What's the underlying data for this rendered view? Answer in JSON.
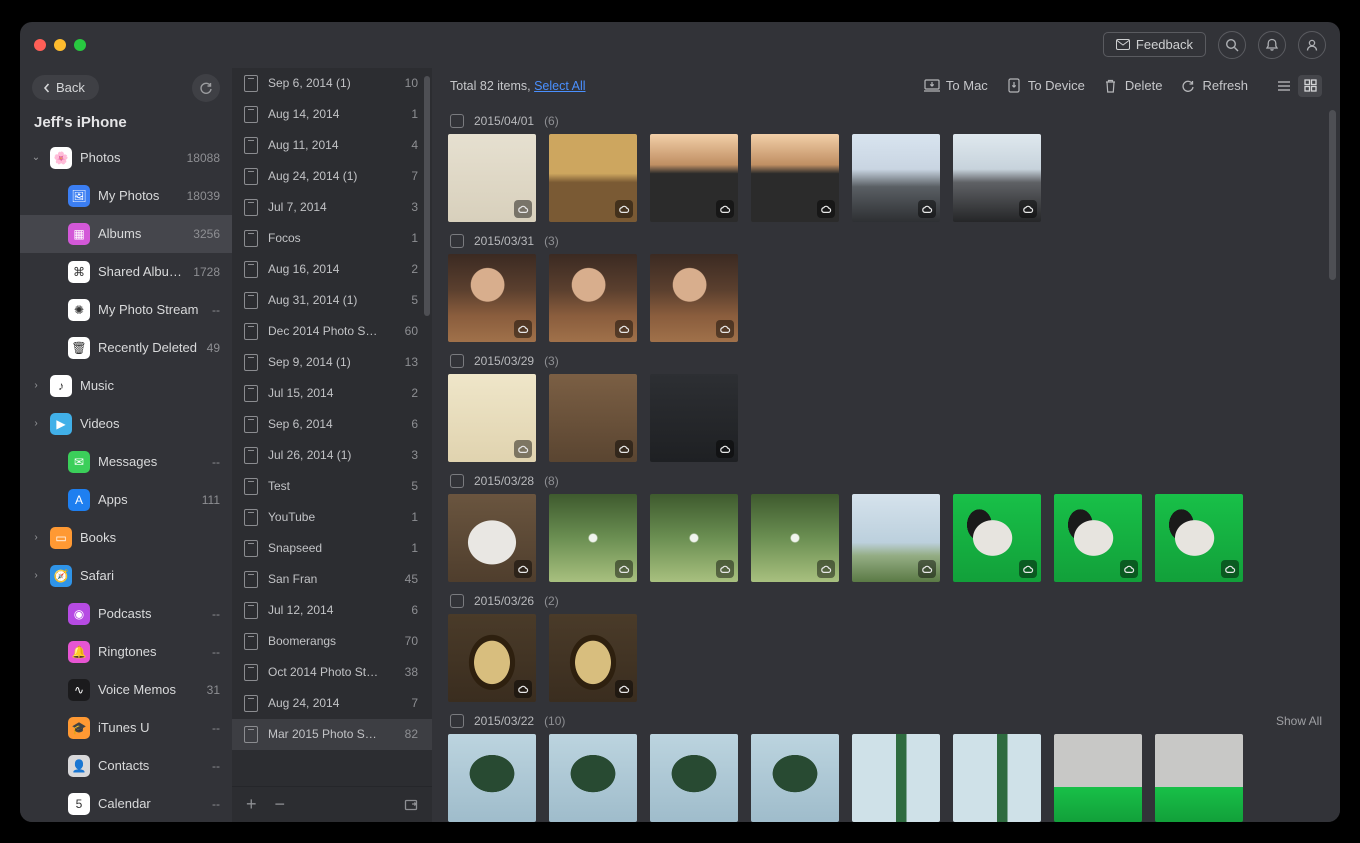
{
  "window": {
    "feedback": "Feedback"
  },
  "sidebar": {
    "back": "Back",
    "device": "Jeff's iPhone",
    "items": [
      {
        "label": "Photos",
        "count": "18088",
        "expandable": true,
        "expanded": true,
        "icon": "photos",
        "iconBg": "#fff"
      },
      {
        "label": "My Photos",
        "count": "18039",
        "sub": true,
        "icon": "my-photos",
        "iconBg": "#3b7ef2"
      },
      {
        "label": "Albums",
        "count": "3256",
        "sub": true,
        "selected": true,
        "icon": "albums",
        "iconBg": "#d358d8"
      },
      {
        "label": "Shared Albums",
        "count": "1728",
        "sub": true,
        "icon": "shared",
        "iconBg": "#fff"
      },
      {
        "label": "My Photo Stream",
        "count": "--",
        "sub": true,
        "icon": "stream",
        "iconBg": "#fff"
      },
      {
        "label": "Recently Deleted",
        "count": "49",
        "sub": true,
        "icon": "trash",
        "iconBg": "#fff"
      },
      {
        "label": "Music",
        "count": "",
        "expandable": true,
        "icon": "music",
        "iconBg": "#fff"
      },
      {
        "label": "Videos",
        "count": "",
        "expandable": true,
        "icon": "videos",
        "iconBg": "#41b0e8"
      },
      {
        "label": "Messages",
        "count": "--",
        "icon": "messages",
        "iconBg": "#3bcf5a"
      },
      {
        "label": "Apps",
        "count": "111",
        "icon": "apps",
        "iconBg": "#1e7ff0"
      },
      {
        "label": "Books",
        "count": "",
        "expandable": true,
        "icon": "books",
        "iconBg": "#ff9933"
      },
      {
        "label": "Safari",
        "count": "",
        "expandable": true,
        "icon": "safari",
        "iconBg": "#2f94e8"
      },
      {
        "label": "Podcasts",
        "count": "--",
        "icon": "podcasts",
        "iconBg": "#b64be3"
      },
      {
        "label": "Ringtones",
        "count": "--",
        "icon": "ringtones",
        "iconBg": "#e755d3"
      },
      {
        "label": "Voice Memos",
        "count": "31",
        "icon": "voice",
        "iconBg": "#1b1b1d"
      },
      {
        "label": "iTunes U",
        "count": "--",
        "icon": "itunesu",
        "iconBg": "#ff9933"
      },
      {
        "label": "Contacts",
        "count": "--",
        "icon": "contacts",
        "iconBg": "#d8d8da",
        "badge": true
      },
      {
        "label": "Calendar",
        "count": "--",
        "icon": "calendar",
        "iconBg": "#fff",
        "badge": true
      }
    ]
  },
  "albums": [
    {
      "label": "Sep 6, 2014 (1)",
      "count": "10"
    },
    {
      "label": "Aug 14, 2014",
      "count": "1"
    },
    {
      "label": "Aug 11, 2014",
      "count": "4"
    },
    {
      "label": "Aug 24, 2014 (1)",
      "count": "7"
    },
    {
      "label": "Jul 7, 2014",
      "count": "3"
    },
    {
      "label": "Focos",
      "count": "1"
    },
    {
      "label": "Aug 16, 2014",
      "count": "2"
    },
    {
      "label": "Aug 31, 2014 (1)",
      "count": "5"
    },
    {
      "label": "Dec 2014 Photo S…",
      "count": "60"
    },
    {
      "label": "Sep 9, 2014 (1)",
      "count": "13"
    },
    {
      "label": "Jul 15, 2014",
      "count": "2"
    },
    {
      "label": "Sep 6, 2014",
      "count": "6"
    },
    {
      "label": "Jul 26, 2014 (1)",
      "count": "3"
    },
    {
      "label": "Test",
      "count": "5"
    },
    {
      "label": "YouTube",
      "count": "1"
    },
    {
      "label": "Snapseed",
      "count": "1"
    },
    {
      "label": "San Fran",
      "count": "45"
    },
    {
      "label": "Jul 12, 2014",
      "count": "6"
    },
    {
      "label": "Boomerangs",
      "count": "70"
    },
    {
      "label": "Oct 2014 Photo St…",
      "count": "38"
    },
    {
      "label": "Aug 24, 2014",
      "count": "7"
    },
    {
      "label": "Mar 2015 Photo S…",
      "count": "82",
      "selected": true
    }
  ],
  "toolbar": {
    "total_prefix": "Total ",
    "total_count": "82",
    "total_mid": " items, ",
    "select_all": "Select All",
    "to_mac": "To Mac",
    "to_device": "To Device",
    "delete": "Delete",
    "refresh": "Refresh"
  },
  "groups": [
    {
      "date": "2015/04/01",
      "count": "(6)",
      "thumbs": [
        "paper",
        "bottles",
        "sky1",
        "sky1",
        "sky2",
        "sky2b"
      ],
      "cloud": true
    },
    {
      "date": "2015/03/31",
      "count": "(3)",
      "thumbs": [
        "woman",
        "woman",
        "woman"
      ],
      "cloud": true
    },
    {
      "date": "2015/03/29",
      "count": "(3)",
      "thumbs": [
        "cream",
        "wood",
        "dark"
      ],
      "cloud": true
    },
    {
      "date": "2015/03/28",
      "count": "(8)",
      "thumbs": [
        "dogw",
        "trees",
        "trees",
        "trees",
        "sky3",
        "dog",
        "dog",
        "dog"
      ],
      "cloud": true
    },
    {
      "date": "2015/03/26",
      "count": "(2)",
      "thumbs": [
        "beer",
        "beer"
      ],
      "cloud": true
    },
    {
      "date": "2015/03/22",
      "count": "(10)",
      "show_all": "Show All",
      "thumbs": [
        "park",
        "park",
        "park",
        "park",
        "park2",
        "park2",
        "room",
        "room"
      ],
      "cloud": false
    }
  ]
}
